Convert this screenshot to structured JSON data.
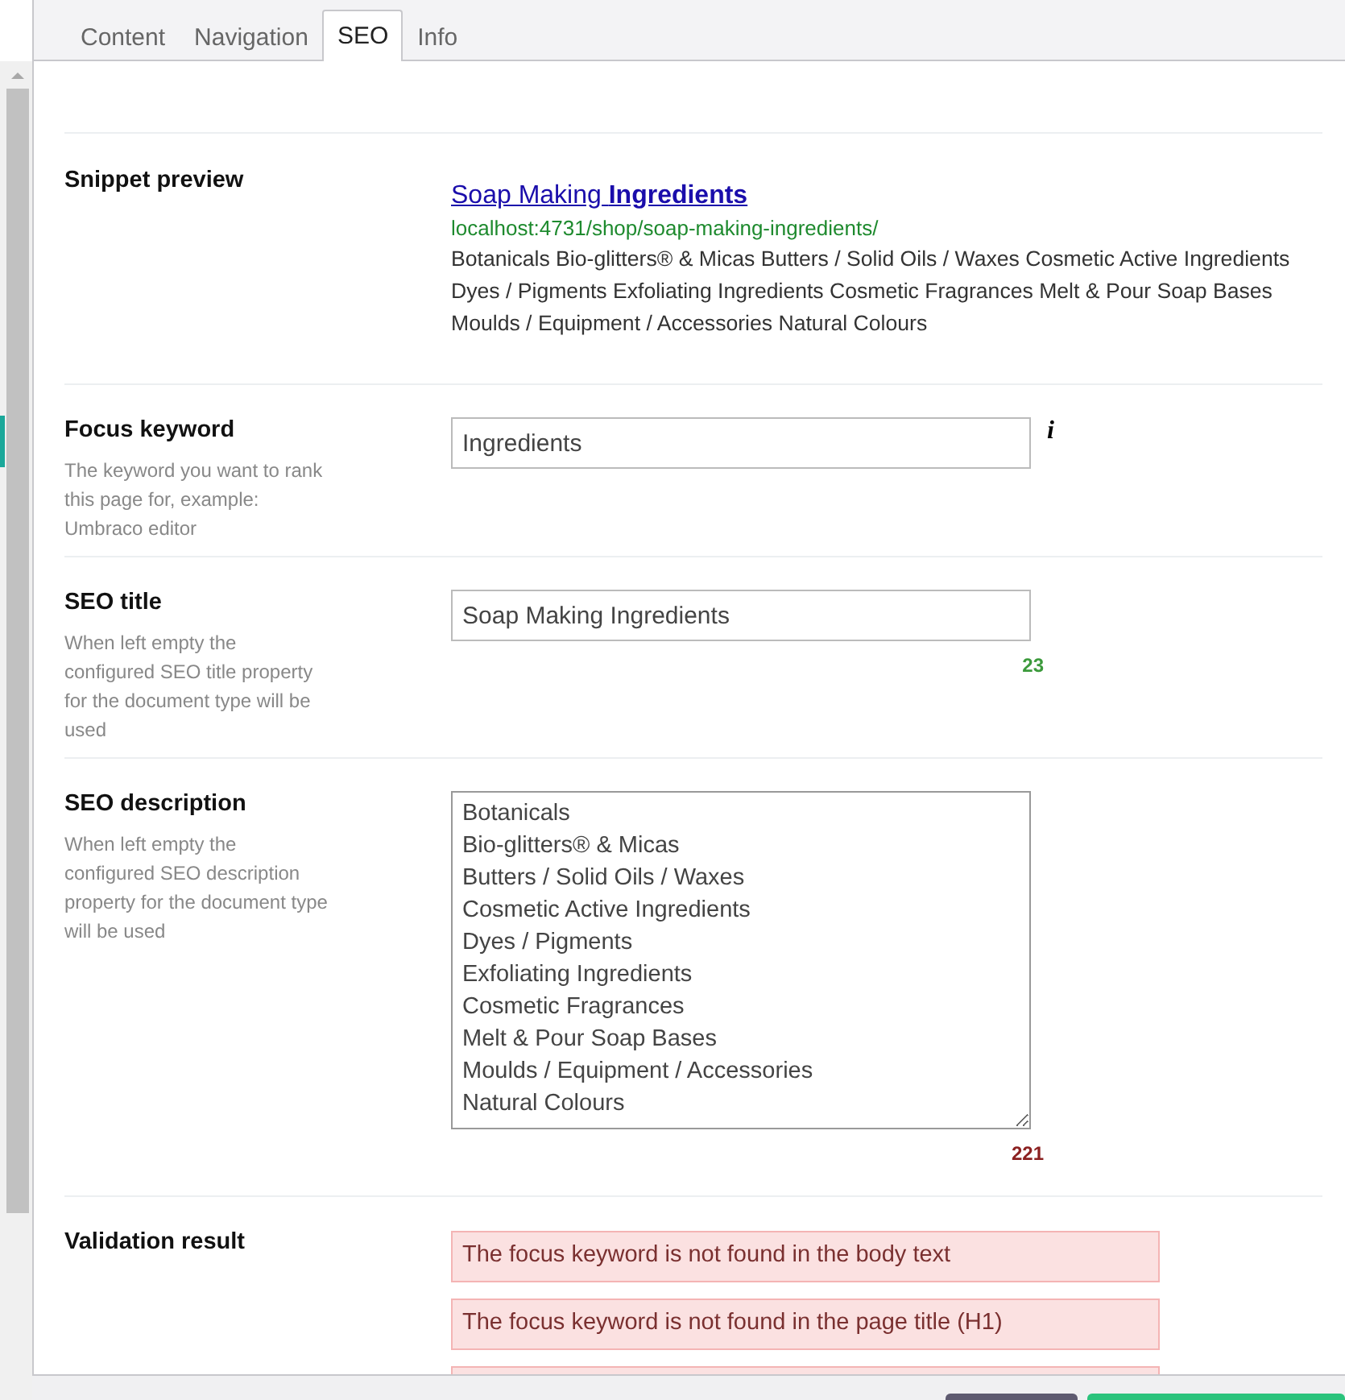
{
  "tabs": [
    {
      "label": "Content",
      "selected": false
    },
    {
      "label": "Navigation",
      "selected": false
    },
    {
      "label": "SEO",
      "selected": true
    },
    {
      "label": "Info",
      "selected": false
    }
  ],
  "snippet": {
    "label": "Snippet preview",
    "title": "Soap Making **Ingredients**",
    "url": "localhost:4731/shop/soap-making-ingredients/",
    "description": "Botanicals Bio-glitters® & Micas Butters / Solid Oils / Waxes Cosmetic Active Ingredients Dyes / Pigments Exfoliating Ingredients Cosmetic Fragrances Melt & Pour Soap Bases Moulds / Equipment / Accessories Natural Colours"
  },
  "fields": [
    {
      "kind": "input",
      "label": "Focus keyword",
      "hint": "The keyword you want to rank this page for, example: Umbraco editor",
      "value": "Ingredients",
      "info_icon": "i"
    },
    {
      "kind": "input",
      "label": "SEO title",
      "hint": "When left empty the configured SEO title property for the document type will be used",
      "value": "Soap Making Ingredients",
      "counter": {
        "text": "23",
        "kind": "ok"
      }
    },
    {
      "kind": "textarea",
      "label": "SEO description",
      "hint": "When left empty the configured SEO description property for the document type will be used",
      "value": "Botanicals\nBio-glitters® & Micas\nButters / Solid Oils / Waxes\nCosmetic Active Ingredients\nDyes / Pigments\nExfoliating Ingredients\nCosmetic Fragrances\nMelt & Pour Soap Bases\nMoulds / Equipment / Accessories\nNatural Colours",
      "counter": {
        "text": "221",
        "kind": "warning"
      }
    }
  ],
  "validation": {
    "label": "Validation result",
    "messages": [
      "The focus keyword is not found in the body text",
      "The focus keyword is not found in the page title (H1)"
    ],
    "more_below": true
  },
  "footer": {
    "buttons": [
      {
        "kind": "secondary"
      },
      {
        "kind": "primary"
      }
    ]
  }
}
